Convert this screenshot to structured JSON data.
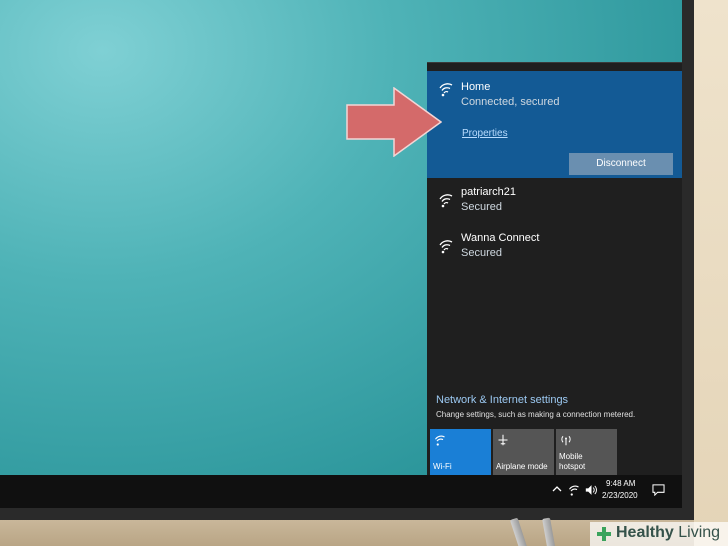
{
  "wifi_flyout": {
    "active_network": {
      "name": "Home",
      "status": "Connected, secured",
      "properties_label": "Properties",
      "disconnect_label": "Disconnect"
    },
    "networks": [
      {
        "name": "patriarch21",
        "status": "Secured"
      },
      {
        "name": "Wanna Connect",
        "status": "Secured"
      }
    ],
    "settings": {
      "title": "Network & Internet settings",
      "description": "Change settings, such as making a connection metered."
    },
    "quick_actions": [
      {
        "label": "Wi-Fi",
        "icon": "wifi-icon",
        "on": true
      },
      {
        "label": "Airplane mode",
        "icon": "airplane-icon",
        "on": false
      },
      {
        "label": "Mobile\nhotspot",
        "icon": "hotspot-icon",
        "on": false
      }
    ]
  },
  "taskbar": {
    "tray_icons": [
      "chevron-up-icon",
      "wifi-icon",
      "volume-icon"
    ],
    "time": "9:48 AM",
    "date": "2/23/2020",
    "notification_icon": "action-center-icon"
  },
  "watermark": {
    "brand_bold": "Healthy",
    "brand_light": " Living"
  },
  "colors": {
    "active_network_bg": "#135a95",
    "flyout_bg": "#1f1f1f",
    "wifi_tile_on": "#1a7fd6",
    "link": "#b9dcff",
    "arrow": "#d46a6a"
  }
}
